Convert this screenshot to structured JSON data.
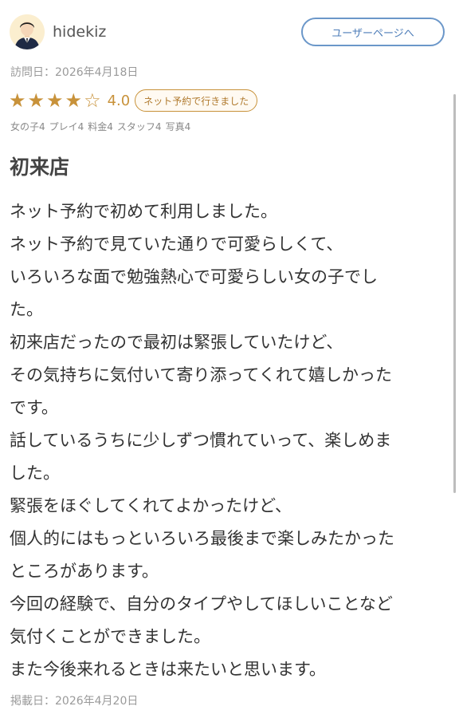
{
  "review": {
    "username": "hidekiz",
    "user_page_button": "ユーザーページへ",
    "visit_date": "訪問日：2026年4月18日",
    "rating": {
      "stars_filled": 4,
      "stars_total": 5,
      "value_text": "4.0"
    },
    "net_badge": "ネット予約で行きました",
    "sub_ratings": [
      "女の子4",
      "プレイ4",
      "料金4",
      "スタッフ4",
      "写真4"
    ],
    "title": "初来店",
    "body_lines": [
      "ネット予約で初めて利用しました。",
      "ネット予約で見ていた通りで可愛らしくて、",
      "いろいろな面で勉強熱心で可愛らしい女の子でし",
      "た。",
      "初来店だったので最初は緊張していたけど、",
      "その気持ちに気付いて寄り添ってくれて嬉しかった",
      "です。",
      "話しているうちに少しずつ慣れていって、楽しめま",
      "した。",
      "緊張をほぐしてくれてよかったけど、",
      "個人的にはもっといろいろ最後まで楽しみたかった",
      "ところがあります。",
      "今回の経験で、自分のタイプやしてほしいことなど",
      "気付くことができました。",
      "また今後来れるときは来たいと思います。"
    ],
    "posted_date": "掲載日：2026年4月20日"
  },
  "colors": {
    "accent_gold": "#c8923a",
    "button_blue": "#6b97c9",
    "muted_text": "#9a9a9a"
  },
  "icons": {
    "avatar": "user-avatar-icon",
    "star_filled": "star-filled-icon",
    "star_empty": "star-outline-icon"
  }
}
